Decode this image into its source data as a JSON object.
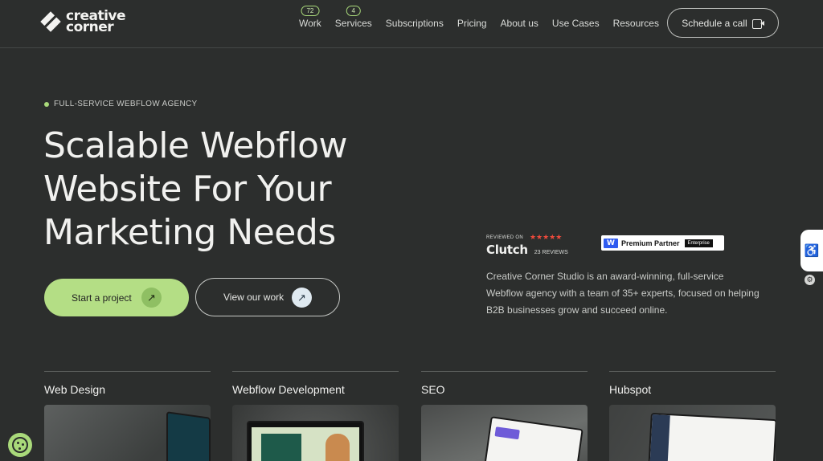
{
  "logo": {
    "line1": "creative",
    "line2": "corner"
  },
  "nav": {
    "items": [
      {
        "label": "Work",
        "badge": "72"
      },
      {
        "label": "Services",
        "badge": "4"
      },
      {
        "label": "Subscriptions",
        "badge": null
      },
      {
        "label": "Pricing",
        "badge": null
      },
      {
        "label": "About us",
        "badge": null
      },
      {
        "label": "Use Cases",
        "badge": null
      },
      {
        "label": "Resources",
        "badge": null
      }
    ],
    "cta_label": "Schedule a call"
  },
  "hero": {
    "eyebrow": "FULL-SERVICE WEBFLOW AGENCY",
    "title": "Scalable Webflow Website For Your Marketing Needs",
    "primary_cta": "Start a project",
    "secondary_cta": "View our work"
  },
  "reviews": {
    "reviewed_on": "REVIEWED ON",
    "stars": "★★★★★",
    "platform": "Clutch",
    "count": "23 REVIEWS",
    "partner_label": "Premium Partner",
    "partner_tier": "Enterprise"
  },
  "description": "Creative Corner Studio is an award-winning, full-service Webflow agency with a team of 35+ experts, focused on helping B2B businesses grow and succeed online.",
  "services": [
    {
      "title": "Web Design"
    },
    {
      "title": "Webflow Development"
    },
    {
      "title": "SEO"
    },
    {
      "title": "Hubspot"
    }
  ],
  "colors": {
    "background": "#2c2e2d",
    "accent_green": "#b4de85",
    "star_red": "#ef4a3c",
    "webflow_blue": "#2f5bf0"
  }
}
